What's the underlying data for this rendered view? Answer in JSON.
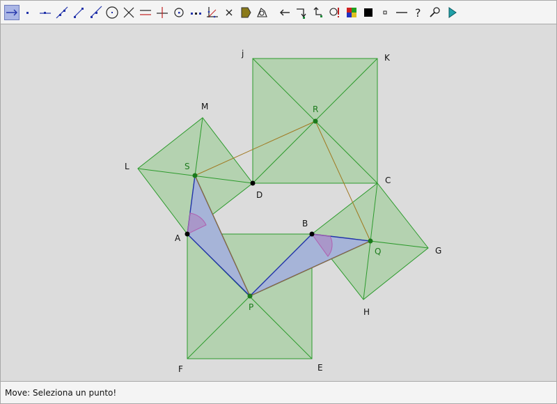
{
  "toolbar": {
    "tools": [
      {
        "name": "move-tool-icon",
        "active": true
      },
      {
        "name": "new-point-tool-icon"
      },
      {
        "name": "point-on-line-tool-icon"
      },
      {
        "name": "line-through-two-points-tool-icon"
      },
      {
        "name": "segment-tool-icon"
      },
      {
        "name": "ray-tool-icon"
      },
      {
        "name": "circle-tool-icon"
      },
      {
        "name": "intersect-tool-icon"
      },
      {
        "name": "parallel-line-tool-icon"
      },
      {
        "name": "perpendicular-line-tool-icon"
      },
      {
        "name": "midpoint-tool-icon"
      },
      {
        "name": "locus-tool-icon"
      },
      {
        "name": "angle-bisector-tool-icon"
      },
      {
        "name": "delete-tool-icon"
      },
      {
        "name": "polygon-tool-icon"
      },
      {
        "name": "measure-tool-icon"
      },
      {
        "name": "undo-tool-icon"
      },
      {
        "name": "translate-tool-icon"
      },
      {
        "name": "rotate-tool-icon"
      },
      {
        "name": "macro-tool-icon"
      },
      {
        "name": "color-palette-icon"
      },
      {
        "name": "fill-style-icon"
      },
      {
        "name": "point-size-icon"
      },
      {
        "name": "line-style-icon"
      },
      {
        "name": "help-icon"
      },
      {
        "name": "zoom-tool-icon"
      },
      {
        "name": "play-icon"
      }
    ]
  },
  "points": {
    "A": "A",
    "B": "B",
    "C": "C",
    "D": "D",
    "E": "E",
    "F": "F",
    "G": "G",
    "H": "H",
    "j": "j",
    "K": "K",
    "L": "L",
    "M": "M",
    "P": "P",
    "Q": "Q",
    "R": "R",
    "S": "S"
  },
  "colors": {
    "square_fill": "#b4d2b0",
    "square_stroke": "#2c9a2c",
    "triangle_fill": "#a6b4d8",
    "triangle_stroke": "#2233aa",
    "connector": "#a07820",
    "angle_mark": "#b060b0",
    "point_black": "#000000",
    "point_green": "#1b7a1b"
  },
  "status": {
    "text": "Move: Seleziona un punto!"
  }
}
